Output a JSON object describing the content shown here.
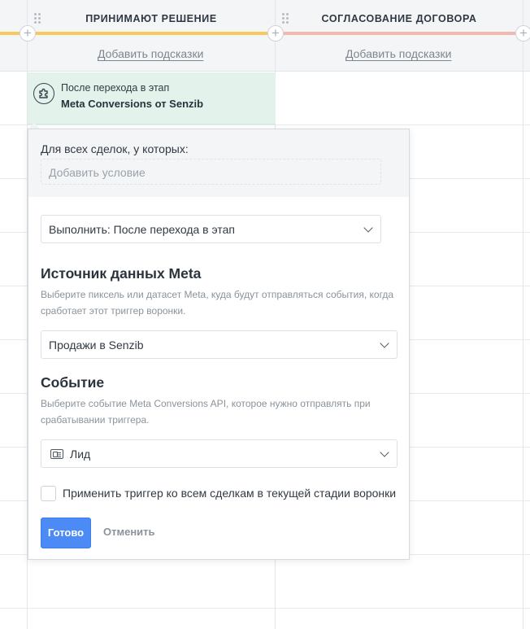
{
  "columns": [
    {
      "title": "ПРИНИМАЮТ РЕШЕНИЕ",
      "hint_link": "Добавить подсказки",
      "stage_color": "#f7c85b"
    },
    {
      "title": "СОГЛАСОВАНИЕ ДОГОВОРА",
      "hint_link": "Добавить подсказки",
      "stage_color": "#f4b8b0"
    }
  ],
  "trigger_card": {
    "subtitle": "После перехода в этап",
    "title": "Meta Conversions от Senzib",
    "icon": "puzzle-icon",
    "background": "#e3f3ec"
  },
  "popover": {
    "condition_label": "Для всех сделок, у которых:",
    "condition_placeholder": "Добавить условие",
    "execute_select": "Выполнить: После перехода в этап",
    "source": {
      "title": "Источник данных Meta",
      "description": "Выберите пиксель или датасет Meta, куда будут отправляться события, когда сработает этот триггер воронки.",
      "selected": "Продажи в Senzib"
    },
    "event": {
      "title": "Событие",
      "description": "Выберите событие Meta Conversions API, которое нужно отправлять при срабатывании триггера.",
      "selected": "Лид",
      "icon": "id-card-icon"
    },
    "apply_checkbox": {
      "label": "Применить триггер ко всем сделкам в текущей стадии воронки",
      "checked": false
    },
    "done_label": "Готово",
    "cancel_label": "Отменить"
  },
  "colors": {
    "primary_button": "#4c8bf5",
    "header_bg": "#f4f5f6"
  }
}
